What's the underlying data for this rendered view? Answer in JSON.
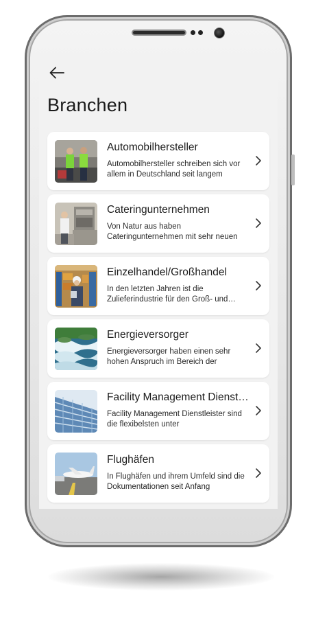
{
  "screen": {
    "title": "Branchen",
    "back_icon": "arrow-left-icon"
  },
  "items": [
    {
      "title": "Automobilhersteller",
      "description": "Automobilhersteller schreiben sich vor allem in Deutschland seit langem",
      "thumbnail": "workers-photo"
    },
    {
      "title": "Cateringunternehmen",
      "description": "Von Natur aus haben Cateringunternehmen mit sehr neuen",
      "thumbnail": "kitchen-photo"
    },
    {
      "title": "Einzelhandel/Großhandel",
      "description": "In den letzten Jahren ist die Zulieferindustrie für den Groß- und Einzelhandel",
      "thumbnail": "warehouse-photo"
    },
    {
      "title": "Energieversorger",
      "description": "Energieversorger haben einen sehr hohen Anspruch im Bereich der",
      "thumbnail": "water-photo"
    },
    {
      "title": "Facility Management Dienstleister",
      "description": "Facility Management Dienstleister sind die flexibelsten unter",
      "thumbnail": "building-photo"
    },
    {
      "title": "Flughäfen",
      "description": "In Flughäfen und ihrem Umfeld sind die Dokumentationen seit Anfang",
      "thumbnail": "airport-photo"
    }
  ]
}
